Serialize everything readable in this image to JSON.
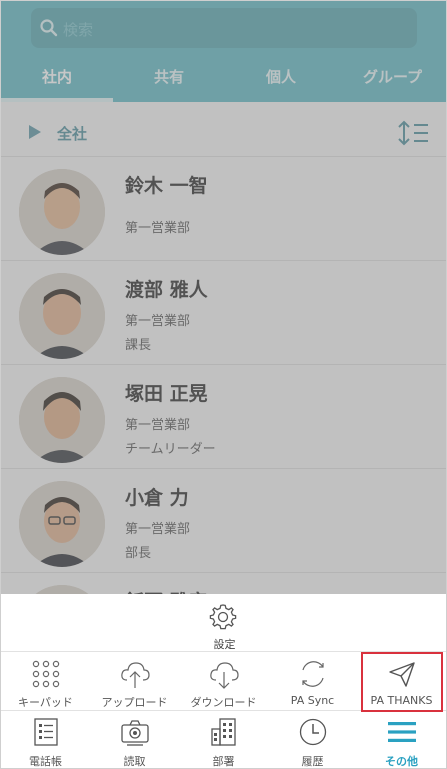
{
  "search": {
    "placeholder": "検索"
  },
  "tabs": [
    {
      "label": "社内",
      "active": true
    },
    {
      "label": "共有",
      "active": false
    },
    {
      "label": "個人",
      "active": false
    },
    {
      "label": "グループ",
      "active": false
    }
  ],
  "section": {
    "label": "全社"
  },
  "people": [
    {
      "name": "鈴木 一智",
      "dept": "第一営業部",
      "title": ""
    },
    {
      "name": "渡部 雅人",
      "dept": "第一営業部",
      "title": "課長"
    },
    {
      "name": "塚田 正晃",
      "dept": "第一営業部",
      "title": "チームリーダー"
    },
    {
      "name": "小倉 力",
      "dept": "第一営業部",
      "title": "部長"
    },
    {
      "name": "飯野 雅彦",
      "dept": "",
      "title": ""
    }
  ],
  "sheet": {
    "settings_label": "設定",
    "actions": [
      {
        "label": "キーパッド",
        "icon": "keypad-icon"
      },
      {
        "label": "アップロード",
        "icon": "cloud-upload-icon"
      },
      {
        "label": "ダウンロード",
        "icon": "cloud-download-icon"
      },
      {
        "label": "PA Sync",
        "icon": "sync-icon"
      },
      {
        "label": "PA THANKS",
        "icon": "paper-plane-icon"
      }
    ]
  },
  "navbar": [
    {
      "label": "電話帳",
      "icon": "contacts-list-icon",
      "active": false
    },
    {
      "label": "読取",
      "icon": "camera-icon",
      "active": false
    },
    {
      "label": "部署",
      "icon": "building-icon",
      "active": false
    },
    {
      "label": "履歴",
      "icon": "clock-icon",
      "active": false
    },
    {
      "label": "その他",
      "icon": "menu-icon",
      "active": true
    }
  ],
  "colors": {
    "header": "#5fb9c4",
    "accent": "#2aa1c1",
    "highlight": "#d9313d"
  }
}
